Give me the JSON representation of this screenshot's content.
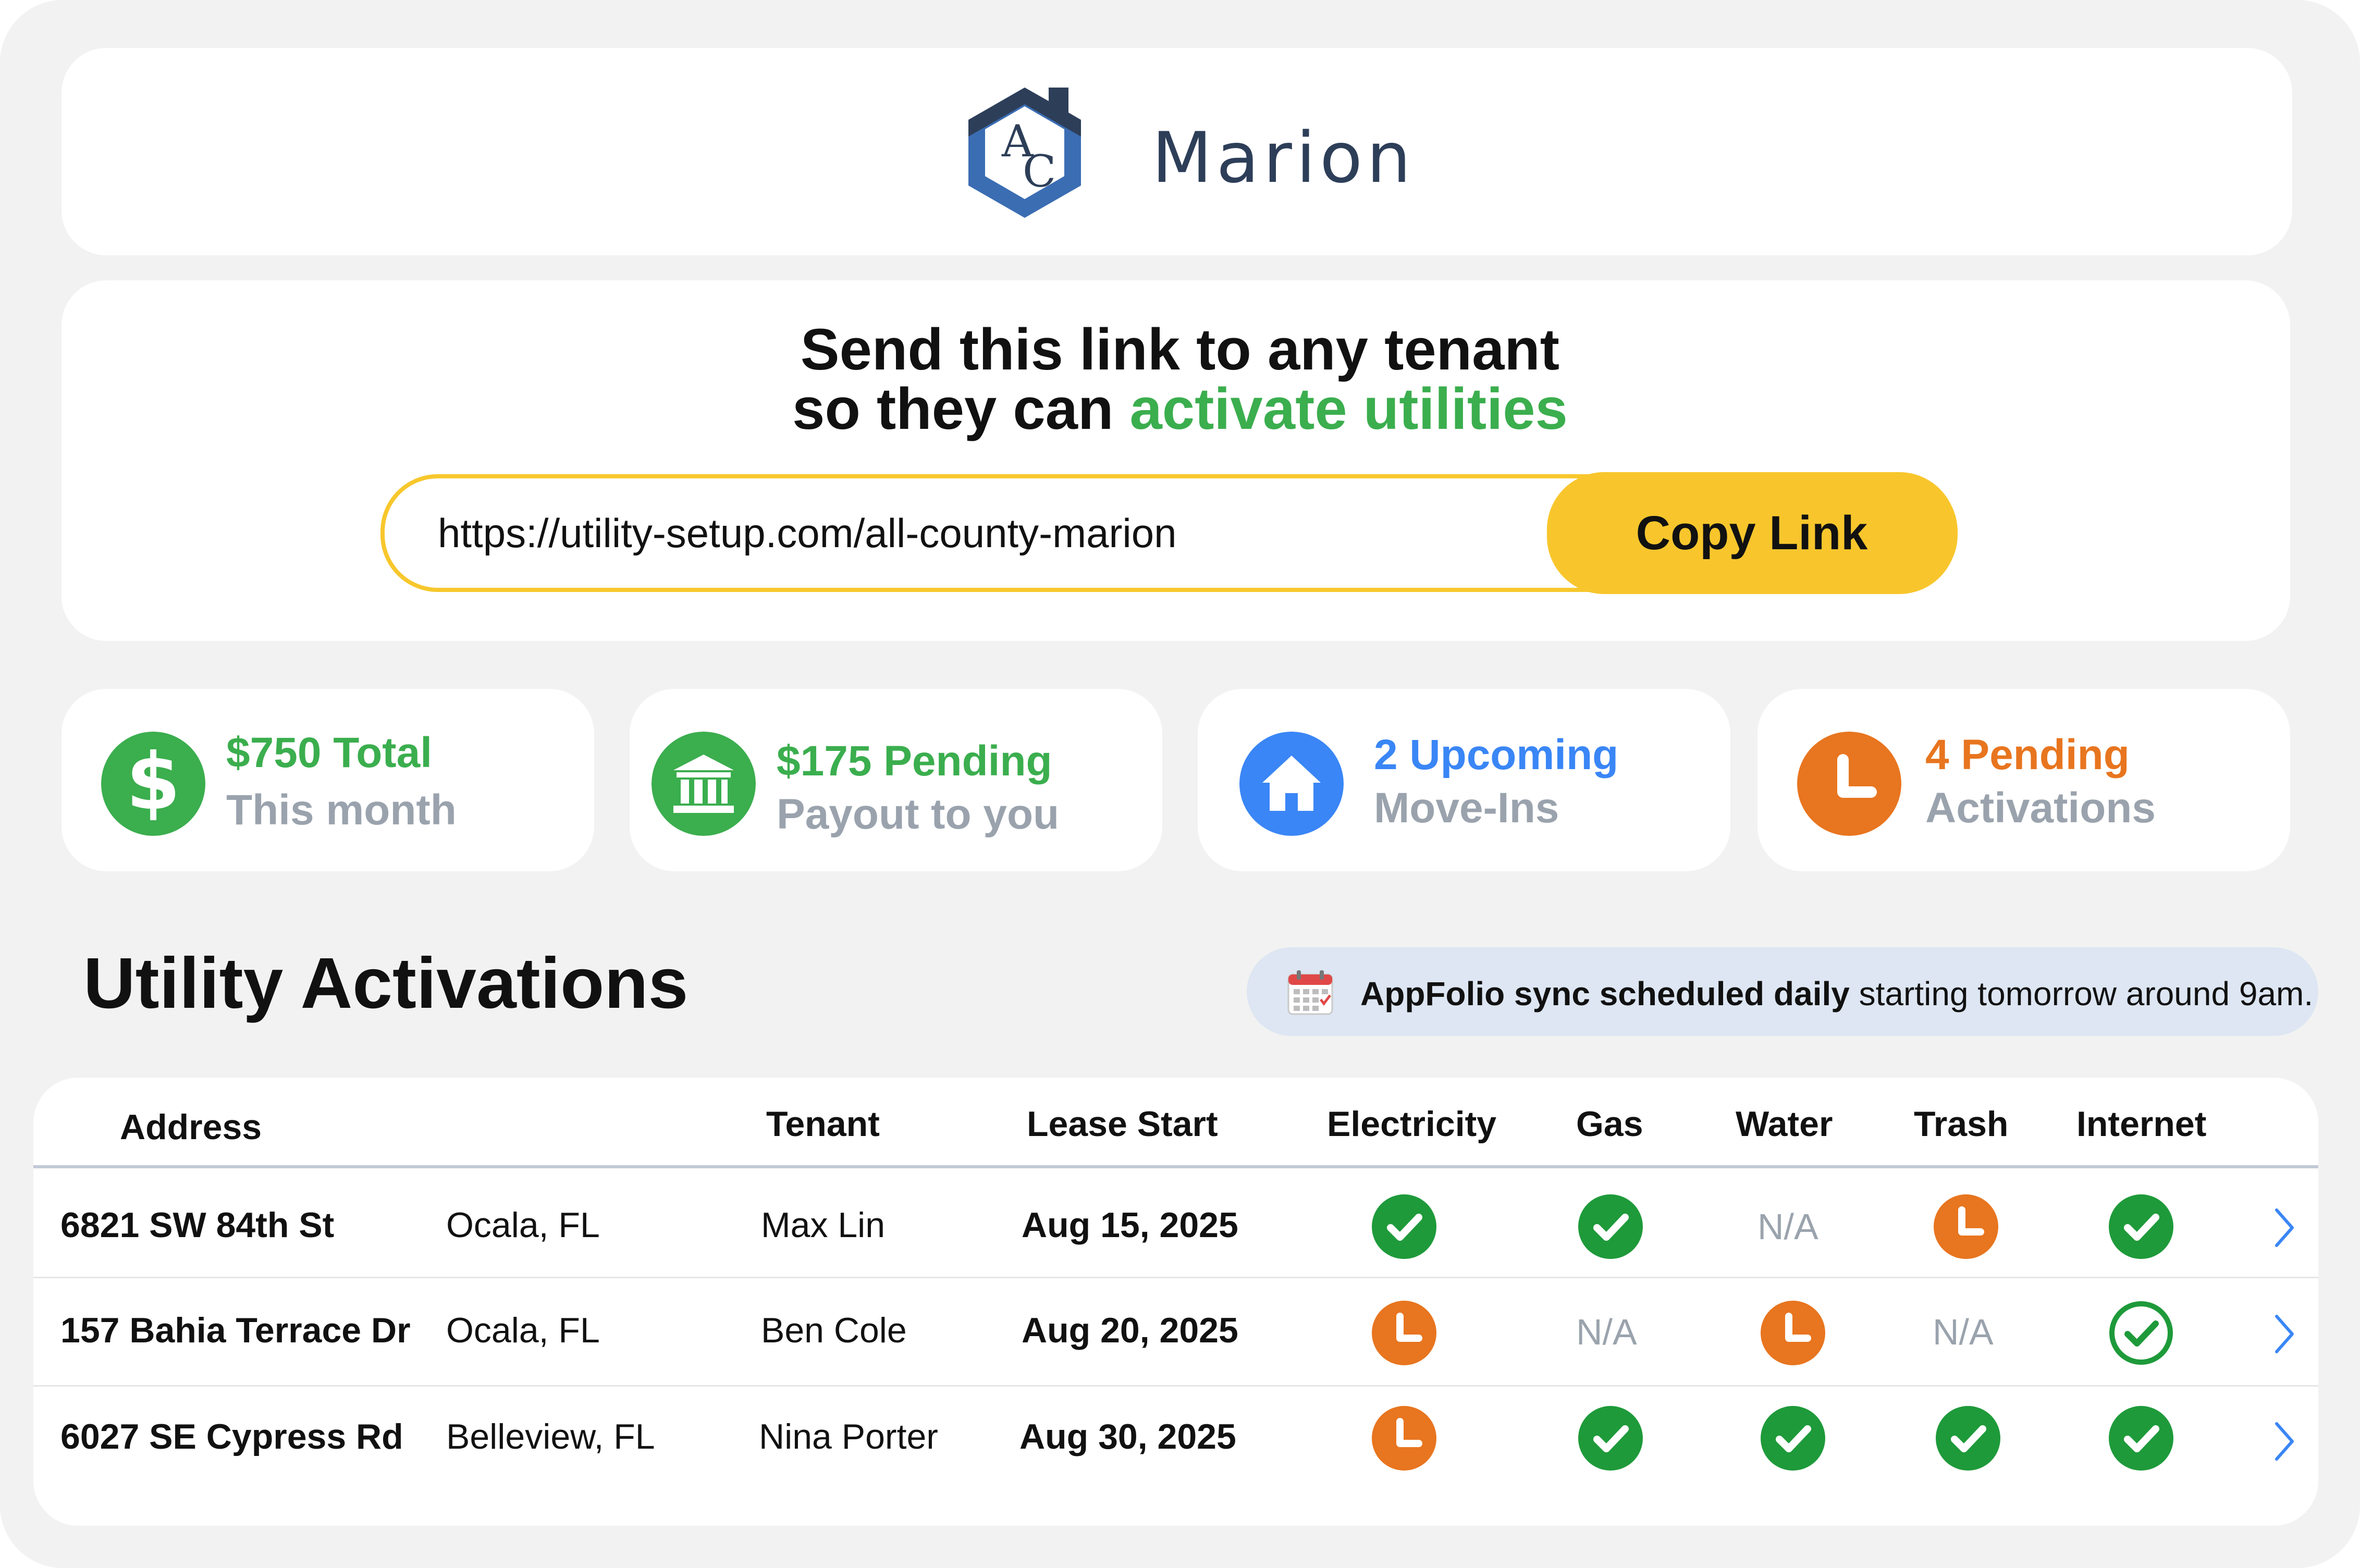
{
  "brand": {
    "logo_name": "AC house logo",
    "name": "Marion"
  },
  "share": {
    "headline_line1": "Send this link to any tenant",
    "headline_line2_prefix": "so they can ",
    "headline_line2_highlight": "activate utilities",
    "url": "https://utility-setup.com/all-county-marion",
    "copy_label": "Copy Link"
  },
  "stats": [
    {
      "icon": "dollar-icon",
      "line1": "$750 Total",
      "line2": "This month",
      "color": "#3bae4e"
    },
    {
      "icon": "bank-icon",
      "line1": "$175 Pending",
      "line2": "Payout to you",
      "color": "#3bae4e"
    },
    {
      "icon": "home-icon",
      "line1": "2 Upcoming",
      "line2": "Move-Ins",
      "color": "#3a86f6"
    },
    {
      "icon": "clock-icon",
      "line1": "4 Pending",
      "line2": "Activations",
      "color": "#e8751f"
    }
  ],
  "activations": {
    "title": "Utility Activations",
    "sync_bold": "AppFolio sync scheduled daily",
    "sync_rest": " starting tomorrow around 9am.",
    "columns": [
      "Address",
      "Tenant",
      "Lease Start",
      "Electricity",
      "Gas",
      "Water",
      "Trash",
      "Internet"
    ],
    "rows": [
      {
        "address": "6821 SW 84th St",
        "city": "Ocala, FL",
        "tenant": "Max Lin",
        "lease_start": "Aug 15, 2025",
        "electricity": "done",
        "gas": "done",
        "water": "N/A",
        "trash": "pending",
        "internet": "done"
      },
      {
        "address": "157 Bahia Terrace Dr",
        "city": "Ocala, FL",
        "tenant": "Ben Cole",
        "lease_start": "Aug 20, 2025",
        "electricity": "pending",
        "gas": "N/A",
        "water": "pending",
        "trash": "N/A",
        "internet": "done-outline"
      },
      {
        "address": "6027 SE Cypress Rd",
        "city": "Belleview, FL",
        "tenant": "Nina Porter",
        "lease_start": "Aug 30, 2025",
        "electricity": "pending",
        "gas": "done",
        "water": "done",
        "trash": "done",
        "internet": "done"
      }
    ]
  },
  "colors": {
    "green": "#1e9a3a",
    "orange": "#e8751f",
    "blue": "#3a86f6",
    "yellow": "#f8c62c",
    "navy": "#2d3e58"
  }
}
